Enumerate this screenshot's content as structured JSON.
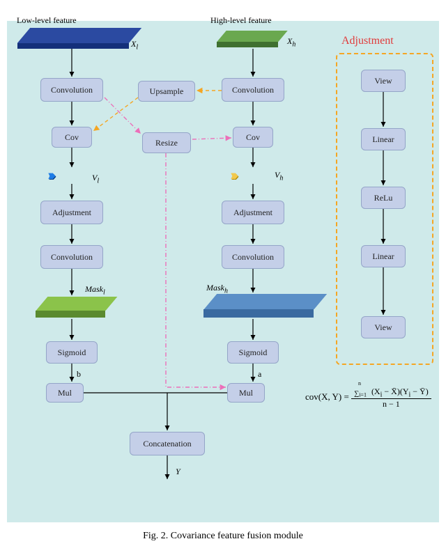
{
  "labels": {
    "low_level": "Low-level feature",
    "high_level": "High-level feature",
    "xl": "X",
    "xl_sub": "l",
    "xh": "X",
    "xh_sub": "h",
    "adjustment_title": "Adjustment",
    "vl": "V",
    "vl_sub": "l",
    "vh": "V",
    "vh_sub": "h",
    "mask_l": "Mask",
    "mask_l_sub": "l",
    "mask_h": "Mask",
    "mask_h_sub": "h",
    "b": "b",
    "a": "a",
    "y": "Y"
  },
  "left_col": {
    "conv1": "Convolution",
    "cov": "Cov",
    "adjust": "Adjustment",
    "conv2": "Convolution",
    "sigmoid": "Sigmoid",
    "mul": "Mul"
  },
  "mid_col": {
    "upsample": "Upsample",
    "resize": "Resize"
  },
  "right_col": {
    "conv1": "Convolution",
    "cov": "Cov",
    "adjust": "Adjustment",
    "conv2": "Convolution",
    "sigmoid": "Sigmoid",
    "mul": "Mul"
  },
  "adjust_col": {
    "view1": "View",
    "linear1": "Linear",
    "relu": "ReLu",
    "linear2": "Linear",
    "view2": "View"
  },
  "bottom": {
    "concat": "Concatenation"
  },
  "formula": {
    "lhs": "cov(X, Y) =",
    "sum_top": "n",
    "sum_bot": "i=1",
    "expr": "(X",
    "expr2": " − X̄)(Y",
    "expr3": " − Ȳ)",
    "den": "n − 1"
  },
  "caption": "Fig. 2. Covariance feature fusion module"
}
